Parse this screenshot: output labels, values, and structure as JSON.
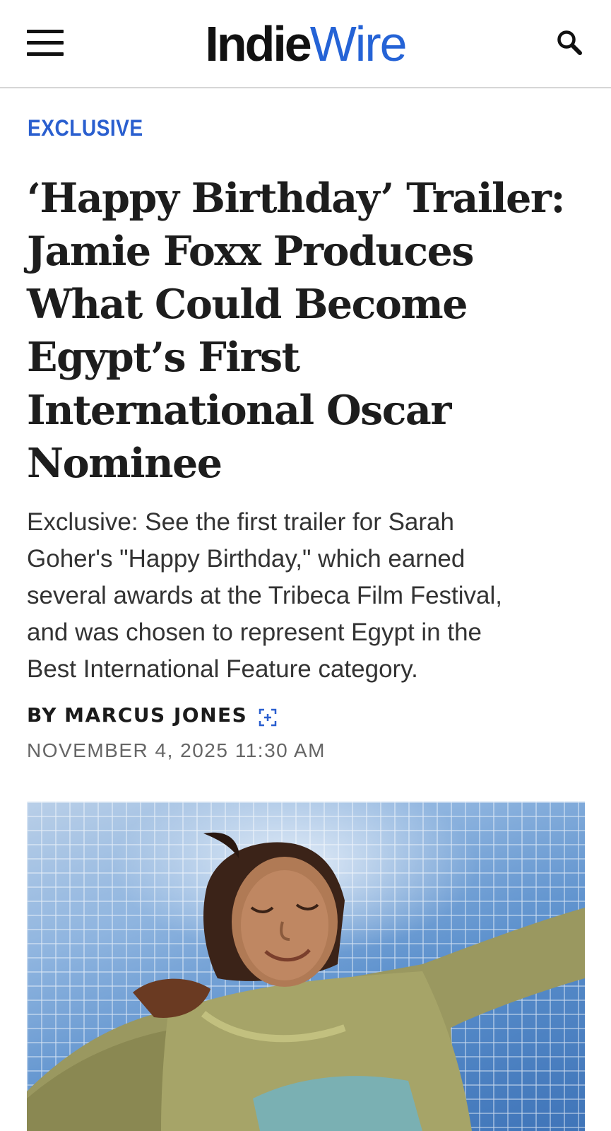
{
  "header": {
    "logo_part1": "Indie",
    "logo_part2": "Wire",
    "menu_icon": "hamburger-menu-icon",
    "search_icon": "search-icon"
  },
  "article": {
    "kicker": "EXCLUSIVE",
    "headline_lines": [
      "‘Happy Birthday’ Trailer:",
      "Jamie Foxx Produces",
      "What Could Become",
      "Egypt’s First",
      "International Oscar",
      "Nominee"
    ],
    "dek_lines": [
      "Exclusive: See the first trailer for Sarah",
      "Goher's \"Happy Birthday,\" which earned",
      "several awards at the Tribeca Film Festival,",
      "and was chosen to represent Egypt in the",
      "Best International Feature category."
    ],
    "byline_prefix": "BY",
    "author": "MARCUS JONES",
    "follow_icon": "follow-author-icon",
    "date": "NOVEMBER 4, 2025 11:30 AM"
  },
  "colors": {
    "brand_blue": "#2563d6",
    "kicker_blue": "#2a5fcf",
    "headline": "#1d1d1d"
  }
}
